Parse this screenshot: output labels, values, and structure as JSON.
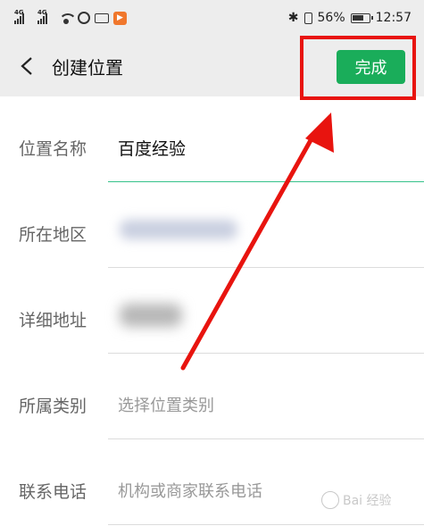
{
  "status_bar": {
    "network_a": "4G",
    "network_b": "4G",
    "battery_percent": "56%",
    "time": "12:57",
    "icons": [
      "signal-icon",
      "signal-icon",
      "wifi-icon",
      "alarm-icon",
      "keyboard-icon",
      "app-notification-icon",
      "bluetooth-icon",
      "vibrate-icon",
      "battery-icon"
    ]
  },
  "title_bar": {
    "back_icon": "chevron-left-icon",
    "title": "创建位置",
    "done_label": "完成",
    "done_color": "#1aad5a"
  },
  "form": {
    "name": {
      "label": "位置名称",
      "value": "百度经验"
    },
    "region": {
      "label": "所在地区",
      "value": ""
    },
    "address": {
      "label": "详细地址",
      "value": ""
    },
    "category": {
      "label": "所属类别",
      "placeholder": "选择位置类别"
    },
    "phone": {
      "label": "联系电话",
      "placeholder": "机构或商家联系电话"
    }
  },
  "annotation": {
    "highlight_color": "#e8140f"
  },
  "watermark": {
    "text": "Bai 经验"
  }
}
